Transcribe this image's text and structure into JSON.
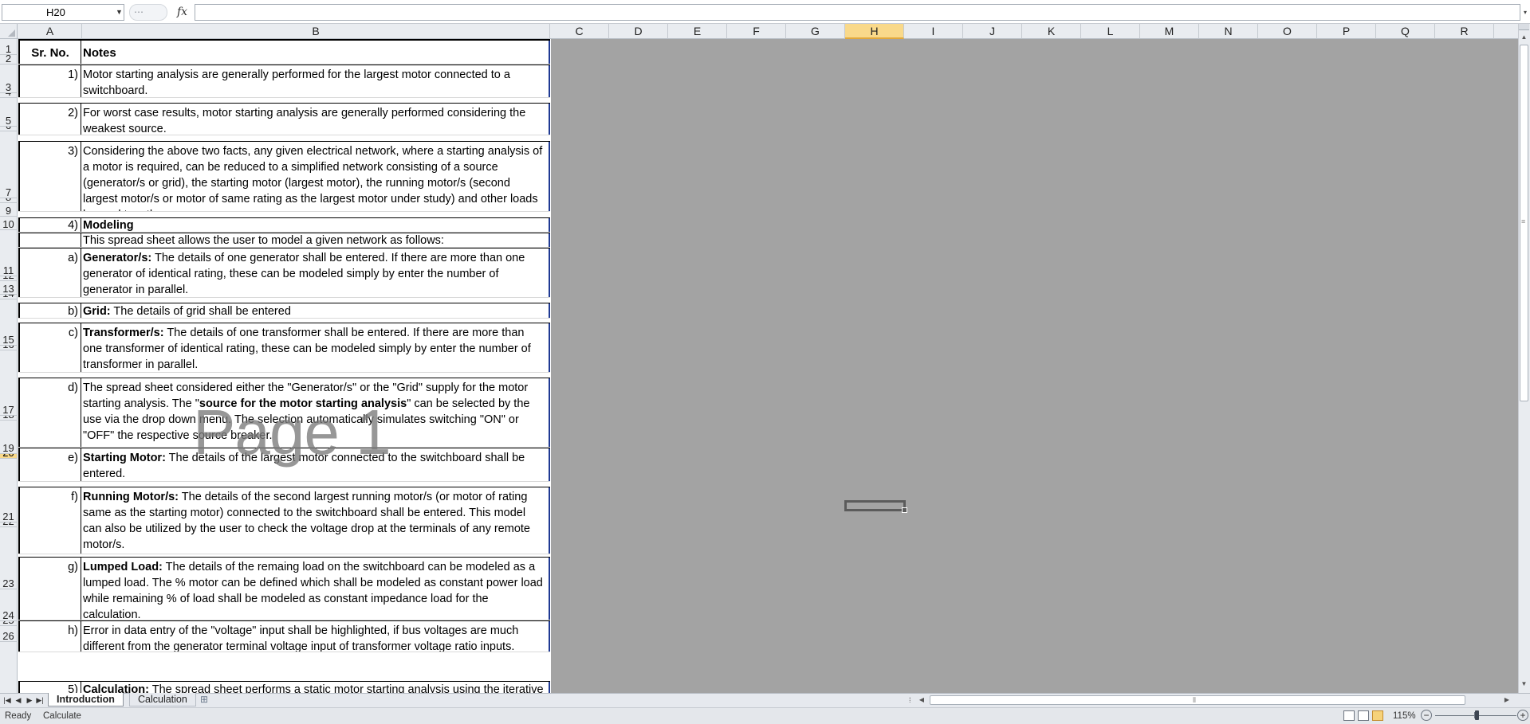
{
  "formula_bar": {
    "name_box": "H20",
    "formula": "",
    "fx_label": "fx"
  },
  "columns": [
    "A",
    "B",
    "C",
    "D",
    "E",
    "F",
    "G",
    "H",
    "I",
    "J",
    "K",
    "L",
    "M",
    "N",
    "O",
    "P",
    "Q",
    "R"
  ],
  "active_column": "H",
  "active_row": "20",
  "rows": [
    {
      "n": "1",
      "h": 20
    },
    {
      "n": "2",
      "h": 12
    },
    {
      "n": "3",
      "h": 36
    },
    {
      "n": "4",
      "h": 6
    },
    {
      "n": "5",
      "h": 36
    },
    {
      "n": "6",
      "h": 6
    },
    {
      "n": "7",
      "h": 84
    },
    {
      "n": "8",
      "h": 6
    },
    {
      "n": "9",
      "h": 17
    },
    {
      "n": "10",
      "h": 17
    },
    {
      "n": "11",
      "h": 58
    },
    {
      "n": "12",
      "h": 6
    },
    {
      "n": "13",
      "h": 17
    },
    {
      "n": "14",
      "h": 6
    },
    {
      "n": "15",
      "h": 58
    },
    {
      "n": "16",
      "h": 6
    },
    {
      "n": "17",
      "h": 82
    },
    {
      "n": "18",
      "h": 6
    },
    {
      "n": "19",
      "h": 42
    },
    {
      "n": "20",
      "h": 6
    },
    {
      "n": "21",
      "h": 80
    },
    {
      "n": "22",
      "h": 6
    },
    {
      "n": "23",
      "h": 78
    },
    {
      "n": "24",
      "h": 40
    },
    {
      "n": "25",
      "h": 6
    },
    {
      "n": "26",
      "h": 20
    }
  ],
  "table": {
    "header": {
      "sr": "Sr. No.",
      "notes": "Notes"
    },
    "r3": {
      "sr": "1)",
      "text": "Motor starting analysis are generally performed for the largest motor connected to a switchboard."
    },
    "r5": {
      "sr": "2)",
      "text": "For worst case results, motor starting analysis are generally performed considering the weakest source."
    },
    "r7": {
      "sr": "3)",
      "text": "Considering the above two facts, any given electrical network, where a starting analysis of a motor is required, can be reduced to a simplified network consisting of a source (generator/s or grid), the starting motor (largest motor), the running motor/s (second largest motor/s or motor of same rating as the largest motor under study) and other loads lumped together."
    },
    "r9": {
      "sr": "4)",
      "text": "Modeling"
    },
    "r10": {
      "sr": "",
      "text": "This spread sheet allows the user to model a given network as follows:"
    },
    "r11": {
      "sr": "a)",
      "bold": "Generator/s:",
      "text": " The details of one generator shall be entered. If there are more than one generator of identical rating, these can be modeled simply by enter the number of generator in parallel."
    },
    "r13": {
      "sr": "b)",
      "bold": "Grid:",
      "text": " The details of grid shall be entered"
    },
    "r15": {
      "sr": "c)",
      "bold": "Transformer/s:",
      "text": " The details of one transformer shall be entered. If there are more than one transformer of identical rating, these can be modeled simply by enter the number of transformer in parallel."
    },
    "r17": {
      "sr": "d)",
      "pre": "The spread sheet considered either the \"Generator/s\" or the \"Grid\" supply for the motor starting analysis. The \"",
      "bold": "source for the motor starting analysis",
      "text": "\" can be selected by the use via the drop down menu. The selection automatically simulates switching \"ON\" or \"OFF\" the respective source breaker."
    },
    "r19": {
      "sr": "e)",
      "bold": "Starting Motor:",
      "text": " The details of the largest motor connected to the switchboard shall be entered."
    },
    "r21": {
      "sr": "f)",
      "bold": "Running Motor/s:",
      "text": " The details of the second largest running motor/s (or motor of rating same as the starting motor) connected to the switchboard shall be entered. This model can also be utilized by the user to check the voltage drop at the terminals of any remote motor/s."
    },
    "r23": {
      "sr": "g)",
      "bold": "Lumped Load:",
      "text": " The details of the remaing load on the switchboard can be modeled as a lumped load. The % motor can be defined which shall be modeled as constant power load while remaining % of load shall be modeled as constant impedance load for the calculation."
    },
    "r24": {
      "sr": "h)",
      "text": "Error in data entry of the \"voltage\" input shall be highlighted, if bus voltages are much different from the generator terminal voltage input of transformer voltage ratio inputs."
    },
    "r26": {
      "sr": "5)",
      "bold": "Calculation:",
      "text": " The spread sheet performs a static motor starting analysis using the iterative"
    }
  },
  "watermark": "Page 1",
  "sheet_tabs": [
    "Introduction",
    "Calculation"
  ],
  "active_tab": "Introduction",
  "status": {
    "ready": "Ready",
    "calculate": "Calculate",
    "zoom": "115%"
  }
}
